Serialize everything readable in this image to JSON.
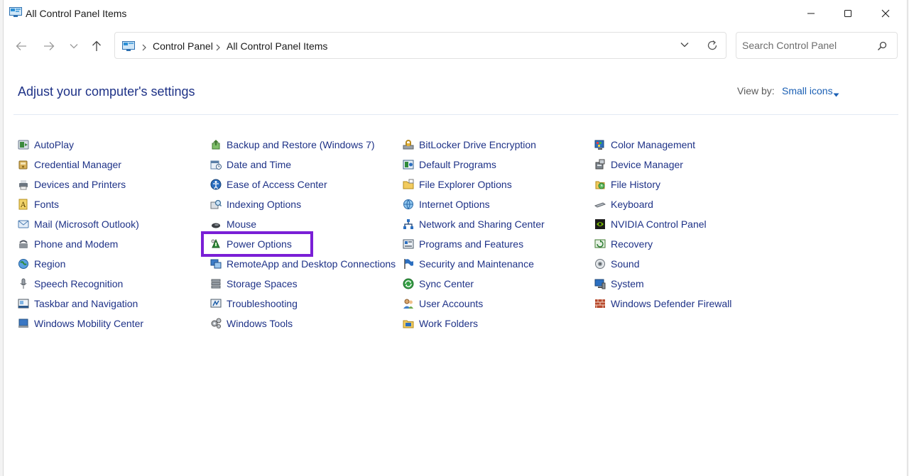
{
  "window": {
    "title": "All Control Panel Items"
  },
  "address": {
    "crumbs": [
      "Control Panel",
      "All Control Panel Items"
    ]
  },
  "search": {
    "placeholder": "Search Control Panel"
  },
  "content": {
    "heading": "Adjust your computer's settings",
    "view_by_label": "View by:",
    "view_by_value": "Small icons",
    "highlighted_item": "Power Options",
    "highlight_color": "#7a1fd6",
    "link_color": "#1e3287"
  },
  "columns": [
    {
      "items": [
        {
          "label": "AutoPlay",
          "icon": "autoplay-icon"
        },
        {
          "label": "Credential Manager",
          "icon": "credential-manager-icon"
        },
        {
          "label": "Devices and Printers",
          "icon": "devices-printers-icon"
        },
        {
          "label": "Fonts",
          "icon": "fonts-icon"
        },
        {
          "label": "Mail (Microsoft Outlook)",
          "icon": "mail-icon"
        },
        {
          "label": "Phone and Modem",
          "icon": "phone-modem-icon"
        },
        {
          "label": "Region",
          "icon": "region-icon"
        },
        {
          "label": "Speech Recognition",
          "icon": "microphone-icon"
        },
        {
          "label": "Taskbar and Navigation",
          "icon": "taskbar-icon"
        },
        {
          "label": "Windows Mobility Center",
          "icon": "mobility-center-icon"
        }
      ]
    },
    {
      "items": [
        {
          "label": "Backup and Restore (Windows 7)",
          "icon": "backup-icon"
        },
        {
          "label": "Date and Time",
          "icon": "date-time-icon"
        },
        {
          "label": "Ease of Access Center",
          "icon": "ease-of-access-icon"
        },
        {
          "label": "Indexing Options",
          "icon": "indexing-icon"
        },
        {
          "label": "Mouse",
          "icon": "mouse-icon"
        },
        {
          "label": "Power Options",
          "icon": "power-options-icon"
        },
        {
          "label": "RemoteApp and Desktop Connections",
          "icon": "remoteapp-icon"
        },
        {
          "label": "Storage Spaces",
          "icon": "storage-spaces-icon"
        },
        {
          "label": "Troubleshooting",
          "icon": "troubleshooting-icon"
        },
        {
          "label": "Windows Tools",
          "icon": "windows-tools-icon"
        }
      ]
    },
    {
      "items": [
        {
          "label": "BitLocker Drive Encryption",
          "icon": "bitlocker-icon"
        },
        {
          "label": "Default Programs",
          "icon": "default-programs-icon"
        },
        {
          "label": "File Explorer Options",
          "icon": "folder-options-icon"
        },
        {
          "label": "Internet Options",
          "icon": "internet-options-icon"
        },
        {
          "label": "Network and Sharing Center",
          "icon": "network-icon"
        },
        {
          "label": "Programs and Features",
          "icon": "programs-features-icon"
        },
        {
          "label": "Security and Maintenance",
          "icon": "flag-icon"
        },
        {
          "label": "Sync Center",
          "icon": "sync-icon"
        },
        {
          "label": "User Accounts",
          "icon": "user-accounts-icon"
        },
        {
          "label": "Work Folders",
          "icon": "work-folders-icon"
        }
      ]
    },
    {
      "items": [
        {
          "label": "Color Management",
          "icon": "color-management-icon"
        },
        {
          "label": "Device Manager",
          "icon": "device-manager-icon"
        },
        {
          "label": "File History",
          "icon": "file-history-icon"
        },
        {
          "label": "Keyboard",
          "icon": "keyboard-icon"
        },
        {
          "label": "NVIDIA Control Panel",
          "icon": "nvidia-icon"
        },
        {
          "label": "Recovery",
          "icon": "recovery-icon"
        },
        {
          "label": "Sound",
          "icon": "sound-icon"
        },
        {
          "label": "System",
          "icon": "system-icon"
        },
        {
          "label": "Windows Defender Firewall",
          "icon": "firewall-icon"
        }
      ]
    }
  ]
}
